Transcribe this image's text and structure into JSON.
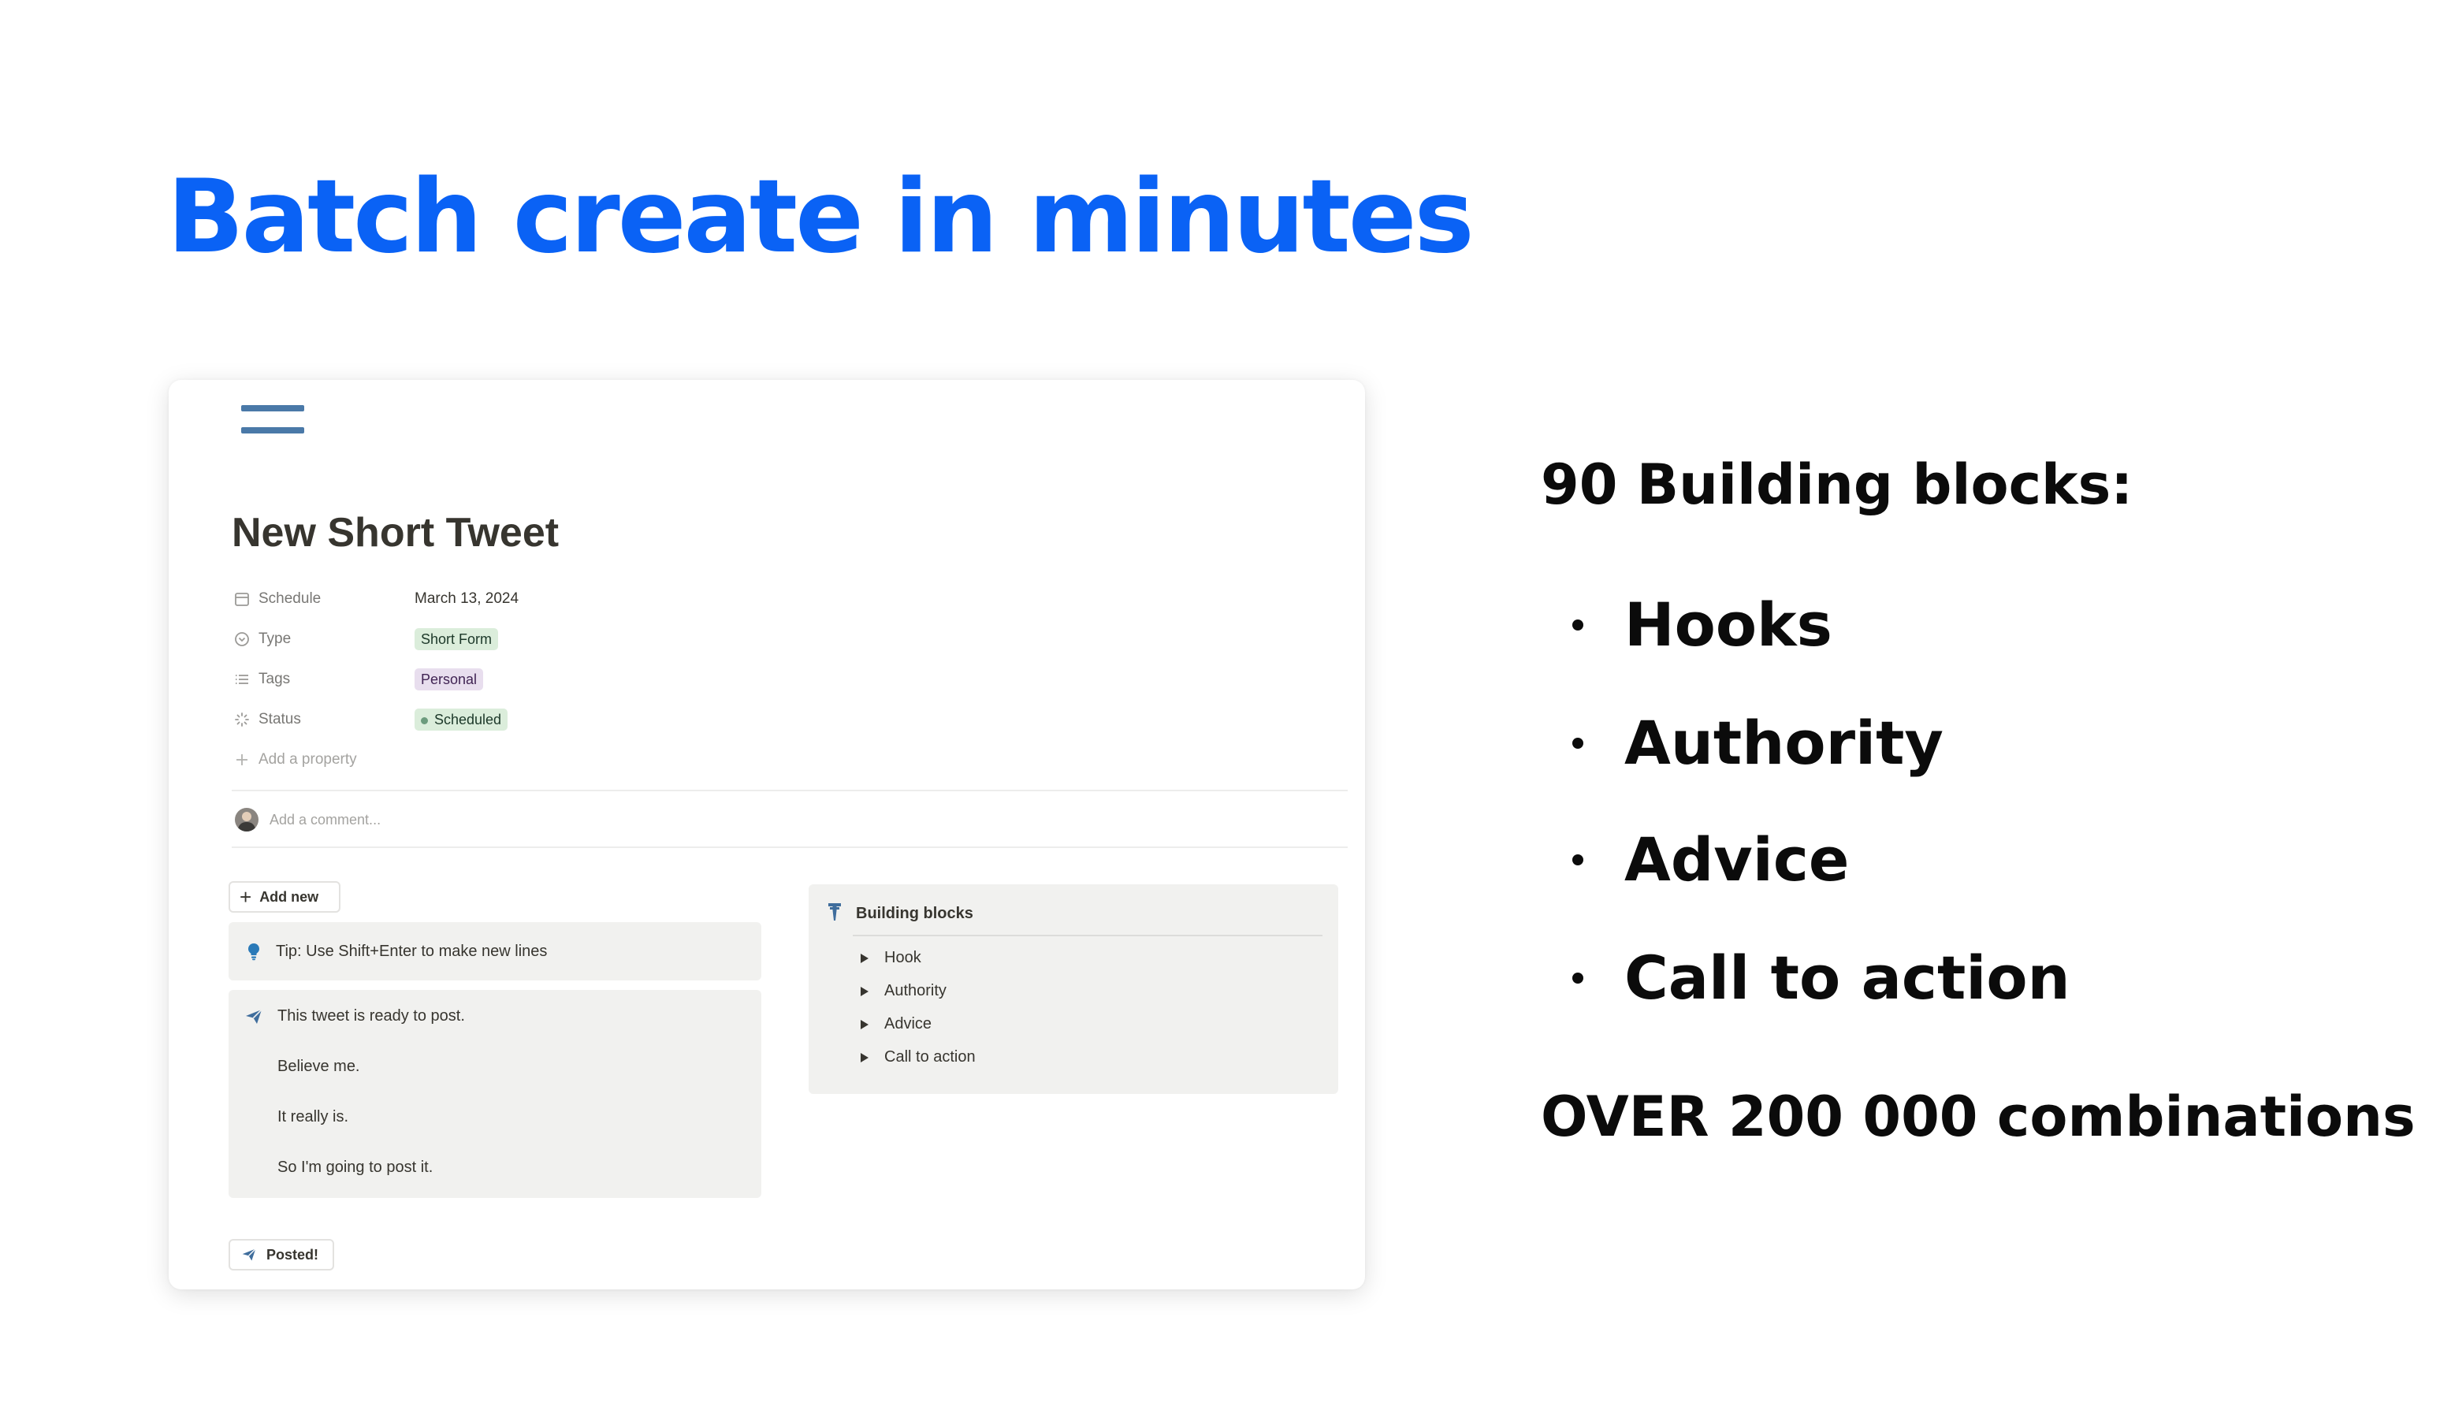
{
  "headline": "Batch create in minutes",
  "colors": {
    "headline": "#0a62f5",
    "menu_icon": "#4a79a8",
    "tag_short_form_bg": "#dbeddb",
    "tag_short_form_fg": "#1c3829",
    "tag_personal_bg": "#e8deee",
    "tag_personal_fg": "#412454",
    "tag_scheduled_bg": "#dbeddb",
    "tag_scheduled_fg": "#1c3829",
    "tag_scheduled_dot": "#6c9b7d",
    "callout_bg": "#f1f1ef",
    "tip_icon": "#2a7ab8",
    "plane_icon": "#3f6d9c"
  },
  "card": {
    "title": "New Short Tweet",
    "properties": [
      {
        "key": "Schedule",
        "icon": "calendar-icon",
        "value": "March 13, 2024",
        "kind": "text"
      },
      {
        "key": "Type",
        "icon": "circle-chevron-icon",
        "value": "Short Form",
        "kind": "tag"
      },
      {
        "key": "Tags",
        "icon": "list-icon",
        "value": "Personal",
        "kind": "tag"
      },
      {
        "key": "Status",
        "icon": "status-spinner-icon",
        "value": "Scheduled",
        "kind": "status"
      }
    ],
    "add_property": "Add a property",
    "comment_placeholder": "Add a comment...",
    "add_new_label": "Add new",
    "tip_text": "Tip: Use Shift+Enter to make new lines",
    "ready_lines": [
      "This tweet is ready to post.",
      "Believe me.",
      "It really is.",
      "So I'm going to post it."
    ],
    "building_blocks": {
      "title": "Building blocks",
      "items": [
        "Hook",
        "Authority",
        "Advice",
        "Call to action"
      ]
    },
    "posted_label": "Posted!"
  },
  "features": {
    "heading": "90 Building blocks:",
    "bullets": [
      "Hooks",
      "Authority",
      "Advice",
      "Call to action"
    ],
    "combinations": "OVER 200 000 combinations"
  }
}
